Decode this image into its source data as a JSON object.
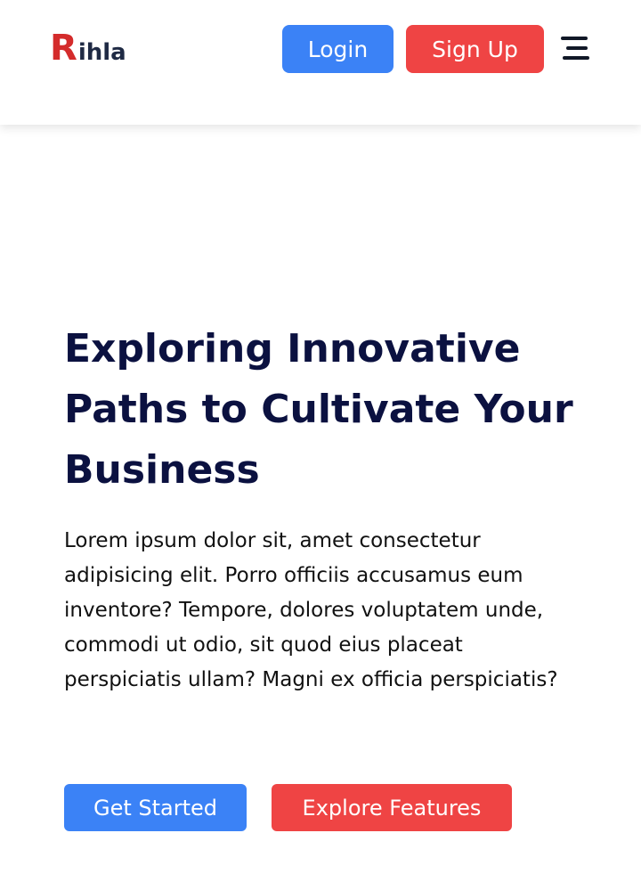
{
  "header": {
    "logo": {
      "initial": "R",
      "rest": "ihla"
    },
    "login_label": "Login",
    "signup_label": "Sign Up",
    "menu_icon": "hamburger-menu-icon"
  },
  "hero": {
    "title": "Exploring Innovative Paths to Cultivate Your Business",
    "text": "Lorem ipsum dolor sit, amet consectetur adipisicing elit. Porro officiis accusamus eum inventore? Tempore, dolores voluptatem unde, commodi ut odio, sit quod eius placeat perspiciatis ullam? Magni ex officia perspiciatis?",
    "primary_cta": "Get Started",
    "secondary_cta": "Explore Features"
  },
  "colors": {
    "brand_red": "#d42b2b",
    "primary_blue": "#3b82f6",
    "accent_red": "#ef4444",
    "heading_navy": "#0b1140"
  }
}
